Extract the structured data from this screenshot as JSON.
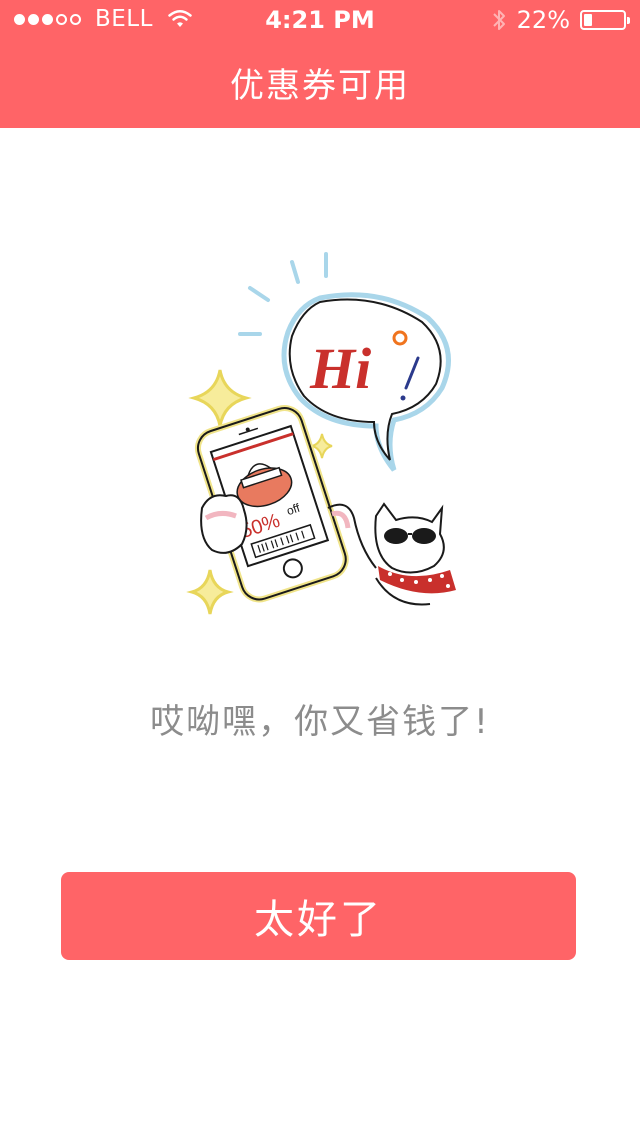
{
  "status_bar": {
    "carrier": "BELL",
    "time": "4:21 PM",
    "battery": "22%",
    "battery_level": 0.22,
    "signal_bars_filled": 3,
    "signal_bars_total": 5
  },
  "nav": {
    "title": "优惠券可用"
  },
  "illustration": {
    "speech_text": "Hi",
    "phone_discount": "50%",
    "phone_off": "off"
  },
  "main": {
    "message": "哎呦嘿，你又省钱了!"
  },
  "actions": {
    "confirm_label": "太好了"
  },
  "colors": {
    "accent": "#ff6467",
    "message_text": "#8c8c8c"
  }
}
